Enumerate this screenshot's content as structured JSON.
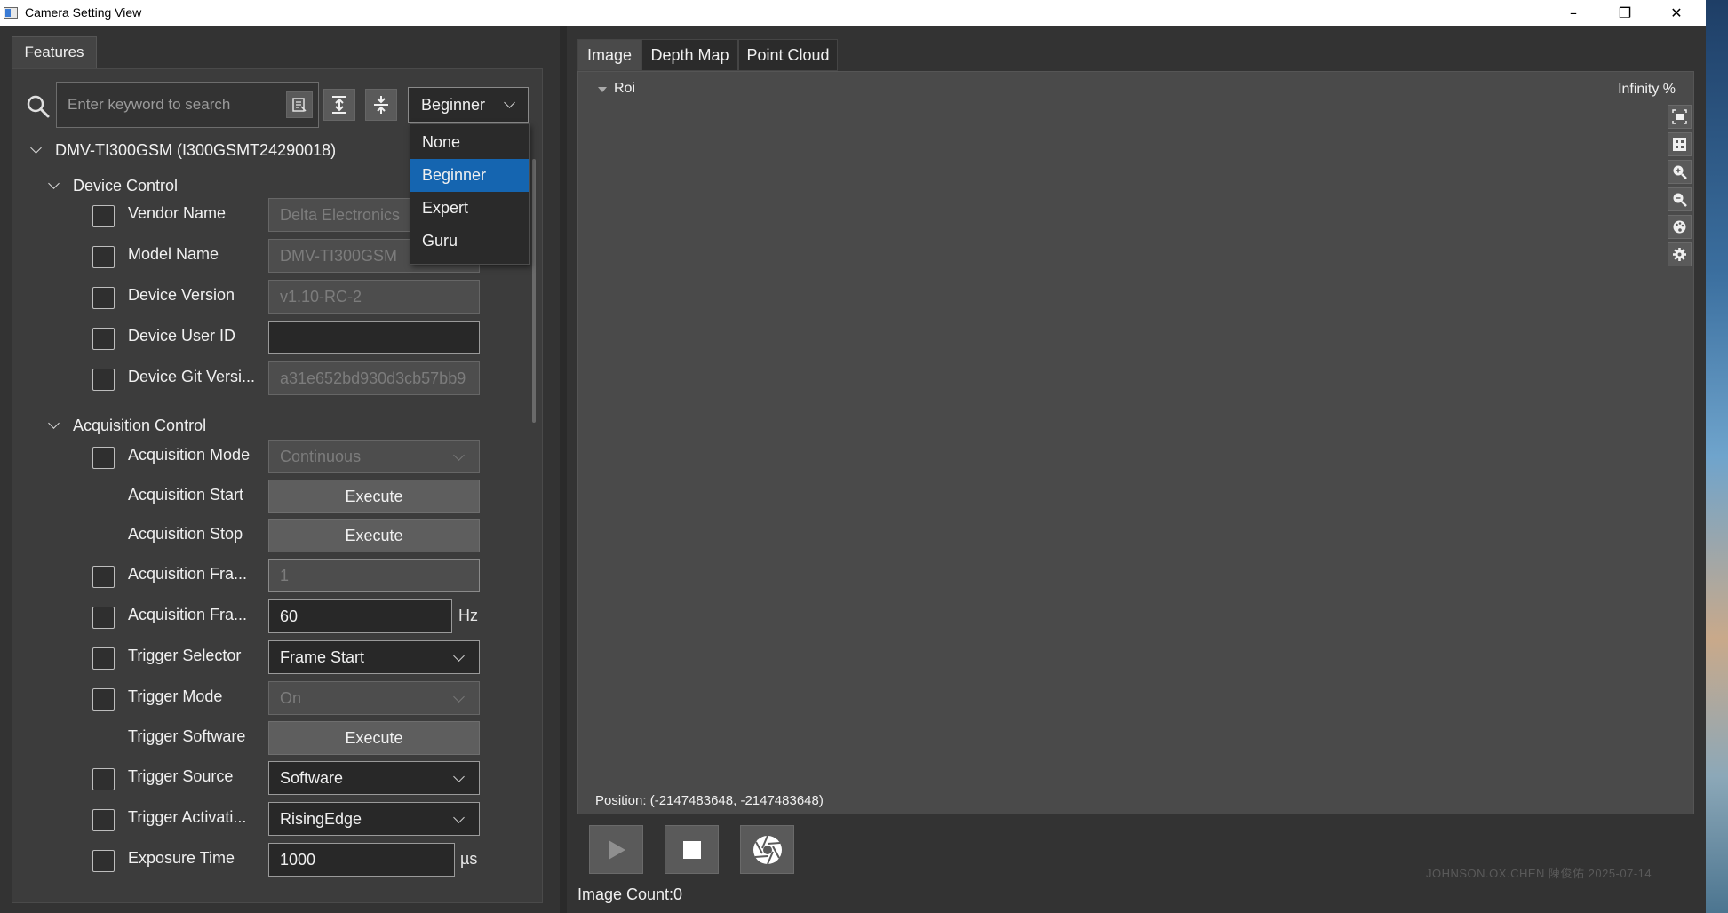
{
  "window": {
    "title": "Camera Setting View",
    "minimize_glyph": "–",
    "restore_glyph": "❐",
    "close_glyph": "✕"
  },
  "left": {
    "tab_label": "Features",
    "search": {
      "placeholder": "Enter keyword to search",
      "value": ""
    },
    "level_select": {
      "value": "Beginner",
      "options": [
        "None",
        "Beginner",
        "Expert",
        "Guru"
      ]
    },
    "device_node": "DMV-TI300GSM (I300GSMT24290018)",
    "groups": {
      "device_control": "Device Control",
      "acquisition_control": "Acquisition Control"
    },
    "device_control_rows": [
      {
        "label": "Vendor Name",
        "value": "Delta Electronics"
      },
      {
        "label": "Model Name",
        "value": "DMV-TI300GSM"
      },
      {
        "label": "Device Version",
        "value": "v1.10-RC-2"
      },
      {
        "label": "Device User ID",
        "value": ""
      },
      {
        "label": "Device Git Versi...",
        "value": "a31e652bd930d3cb57bb9"
      }
    ],
    "acquisition_rows": [
      {
        "label": "Acquisition Mode",
        "value": "Continuous"
      },
      {
        "label": "Acquisition Start",
        "value": "Execute"
      },
      {
        "label": "Acquisition Stop",
        "value": "Execute"
      },
      {
        "label": "Acquisition Fra...",
        "value": "1"
      },
      {
        "label": "Acquisition Fra...",
        "value": "60",
        "unit": "Hz"
      },
      {
        "label": "Trigger Selector",
        "value": "Frame Start"
      },
      {
        "label": "Trigger Mode",
        "value": "On"
      },
      {
        "label": "Trigger Software",
        "value": "Execute"
      },
      {
        "label": "Trigger Source",
        "value": "Software"
      },
      {
        "label": "Trigger Activati...",
        "value": "RisingEdge"
      },
      {
        "label": "Exposure Time",
        "value": "1000",
        "unit": "µs"
      }
    ]
  },
  "right": {
    "tabs": [
      {
        "label": "Image",
        "active": true
      },
      {
        "label": "Depth Map",
        "active": false
      },
      {
        "label": "Point Cloud",
        "active": false
      }
    ],
    "roi_label": "Roi",
    "zoom_label": "Infinity %",
    "position_text": "Position: (-2147483648, -2147483648)",
    "image_count": "Image Count:0",
    "watermark": "JOHNSON.OX.CHEN 陳俊佑 2025-07-14"
  },
  "colors": {
    "accent_selected": "#1565b0",
    "panel_bg": "#3c3c3c",
    "viewer_bg": "#4a4a4a"
  },
  "icons": [
    "search-icon",
    "clear-search-icon",
    "expand-all-icon",
    "collapse-all-icon",
    "fit-icon",
    "actual-size-icon",
    "zoom-in-icon",
    "zoom-out-icon",
    "palette-icon",
    "settings-icon",
    "play-icon",
    "stop-icon",
    "shutter-icon"
  ]
}
